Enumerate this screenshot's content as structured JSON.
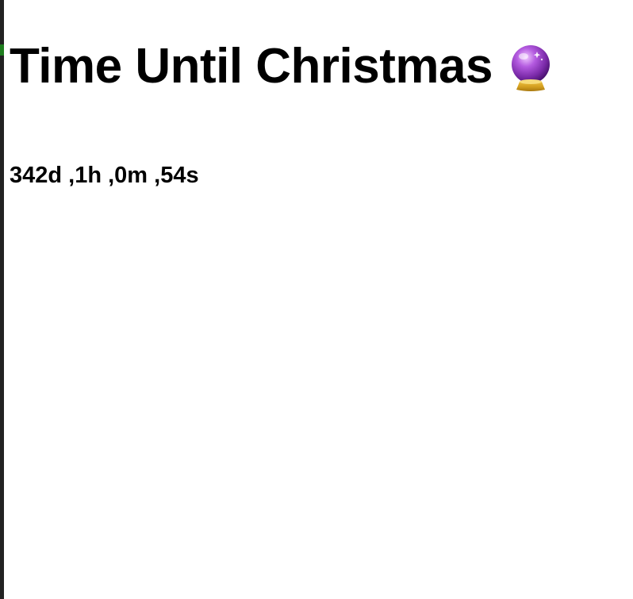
{
  "page": {
    "title": "Time Until Christmas",
    "title_icon": "crystal-ball-icon",
    "countdown_text": "342d ,1h ,0m ,54s"
  },
  "countdown": {
    "days": 342,
    "hours": 1,
    "minutes": 0,
    "seconds": 54
  },
  "colors": {
    "background": "#ffffff",
    "text": "#000000",
    "edge": "#222222",
    "edge_accent": "#1e7d1e",
    "orb_purple": "#9b3fc4",
    "orb_base_gold": "#d4a020"
  }
}
